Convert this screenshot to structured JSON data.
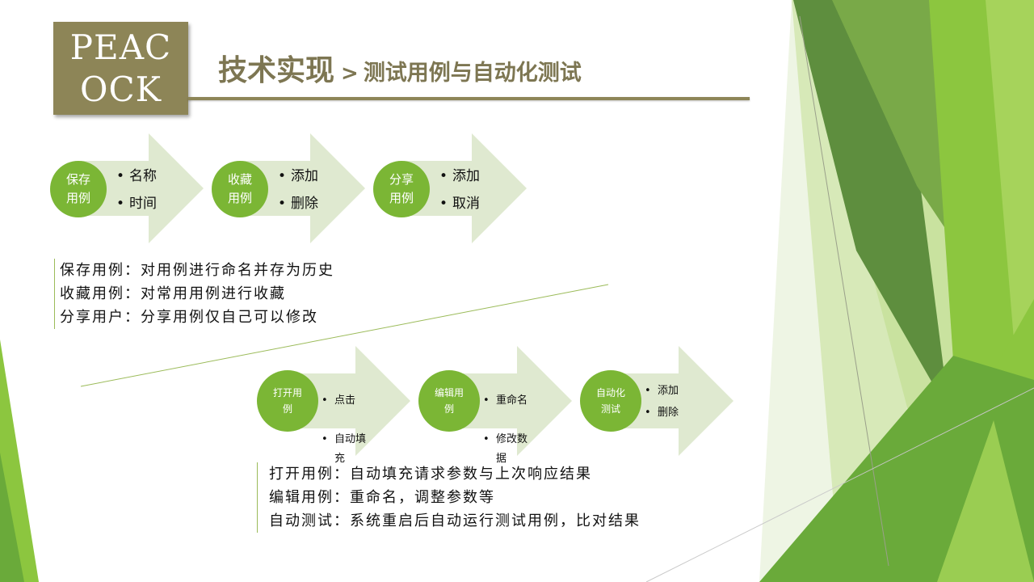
{
  "logo": {
    "line1": "PEAC",
    "line2": "OCK"
  },
  "header": {
    "title_main": "技术实现",
    "separator": ">",
    "title_sub": "测试用例与自动化测试"
  },
  "top_steps": [
    {
      "label": "保存\n用例",
      "items": [
        "名称",
        "时间"
      ]
    },
    {
      "label": "收藏\n用例",
      "items": [
        "添加",
        "删除"
      ]
    },
    {
      "label": "分享\n用例",
      "items": [
        "添加",
        "取消"
      ]
    }
  ],
  "top_desc": [
    "保存用例：对用例进行命名并存为历史",
    "收藏用例：对常用用例进行收藏",
    "分享用户：分享用例仅自己可以修改"
  ],
  "bottom_steps": [
    {
      "label": "打开用\n例",
      "items": [
        "点击",
        "自动填\n充"
      ]
    },
    {
      "label": "编辑用\n例",
      "items": [
        "重命名",
        "修改数\n据"
      ]
    },
    {
      "label": "自动化\n测试",
      "items": [
        "添加",
        "删除"
      ]
    }
  ],
  "bottom_desc": [
    "打开用例：自动填充请求参数与上次响应结果",
    "编辑用例：重命名，调整参数等",
    "自动测试：系统重启后自动运行测试用例，比对结果"
  ],
  "colors": {
    "accent_olive": "#8d8557",
    "circle_green": "#7bb635",
    "arrow_fill": "#dfe9d0"
  }
}
